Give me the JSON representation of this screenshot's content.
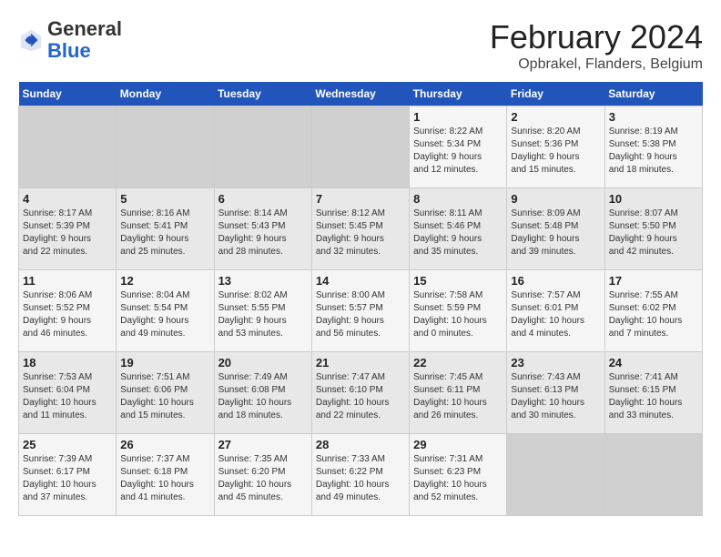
{
  "header": {
    "logo_general": "General",
    "logo_blue": "Blue",
    "main_title": "February 2024",
    "subtitle": "Opbrakel, Flanders, Belgium"
  },
  "days_of_week": [
    "Sunday",
    "Monday",
    "Tuesday",
    "Wednesday",
    "Thursday",
    "Friday",
    "Saturday"
  ],
  "weeks": [
    [
      {
        "day": "",
        "info": ""
      },
      {
        "day": "",
        "info": ""
      },
      {
        "day": "",
        "info": ""
      },
      {
        "day": "",
        "info": ""
      },
      {
        "day": "1",
        "info": "Sunrise: 8:22 AM\nSunset: 5:34 PM\nDaylight: 9 hours\nand 12 minutes."
      },
      {
        "day": "2",
        "info": "Sunrise: 8:20 AM\nSunset: 5:36 PM\nDaylight: 9 hours\nand 15 minutes."
      },
      {
        "day": "3",
        "info": "Sunrise: 8:19 AM\nSunset: 5:38 PM\nDaylight: 9 hours\nand 18 minutes."
      }
    ],
    [
      {
        "day": "4",
        "info": "Sunrise: 8:17 AM\nSunset: 5:39 PM\nDaylight: 9 hours\nand 22 minutes."
      },
      {
        "day": "5",
        "info": "Sunrise: 8:16 AM\nSunset: 5:41 PM\nDaylight: 9 hours\nand 25 minutes."
      },
      {
        "day": "6",
        "info": "Sunrise: 8:14 AM\nSunset: 5:43 PM\nDaylight: 9 hours\nand 28 minutes."
      },
      {
        "day": "7",
        "info": "Sunrise: 8:12 AM\nSunset: 5:45 PM\nDaylight: 9 hours\nand 32 minutes."
      },
      {
        "day": "8",
        "info": "Sunrise: 8:11 AM\nSunset: 5:46 PM\nDaylight: 9 hours\nand 35 minutes."
      },
      {
        "day": "9",
        "info": "Sunrise: 8:09 AM\nSunset: 5:48 PM\nDaylight: 9 hours\nand 39 minutes."
      },
      {
        "day": "10",
        "info": "Sunrise: 8:07 AM\nSunset: 5:50 PM\nDaylight: 9 hours\nand 42 minutes."
      }
    ],
    [
      {
        "day": "11",
        "info": "Sunrise: 8:06 AM\nSunset: 5:52 PM\nDaylight: 9 hours\nand 46 minutes."
      },
      {
        "day": "12",
        "info": "Sunrise: 8:04 AM\nSunset: 5:54 PM\nDaylight: 9 hours\nand 49 minutes."
      },
      {
        "day": "13",
        "info": "Sunrise: 8:02 AM\nSunset: 5:55 PM\nDaylight: 9 hours\nand 53 minutes."
      },
      {
        "day": "14",
        "info": "Sunrise: 8:00 AM\nSunset: 5:57 PM\nDaylight: 9 hours\nand 56 minutes."
      },
      {
        "day": "15",
        "info": "Sunrise: 7:58 AM\nSunset: 5:59 PM\nDaylight: 10 hours\nand 0 minutes."
      },
      {
        "day": "16",
        "info": "Sunrise: 7:57 AM\nSunset: 6:01 PM\nDaylight: 10 hours\nand 4 minutes."
      },
      {
        "day": "17",
        "info": "Sunrise: 7:55 AM\nSunset: 6:02 PM\nDaylight: 10 hours\nand 7 minutes."
      }
    ],
    [
      {
        "day": "18",
        "info": "Sunrise: 7:53 AM\nSunset: 6:04 PM\nDaylight: 10 hours\nand 11 minutes."
      },
      {
        "day": "19",
        "info": "Sunrise: 7:51 AM\nSunset: 6:06 PM\nDaylight: 10 hours\nand 15 minutes."
      },
      {
        "day": "20",
        "info": "Sunrise: 7:49 AM\nSunset: 6:08 PM\nDaylight: 10 hours\nand 18 minutes."
      },
      {
        "day": "21",
        "info": "Sunrise: 7:47 AM\nSunset: 6:10 PM\nDaylight: 10 hours\nand 22 minutes."
      },
      {
        "day": "22",
        "info": "Sunrise: 7:45 AM\nSunset: 6:11 PM\nDaylight: 10 hours\nand 26 minutes."
      },
      {
        "day": "23",
        "info": "Sunrise: 7:43 AM\nSunset: 6:13 PM\nDaylight: 10 hours\nand 30 minutes."
      },
      {
        "day": "24",
        "info": "Sunrise: 7:41 AM\nSunset: 6:15 PM\nDaylight: 10 hours\nand 33 minutes."
      }
    ],
    [
      {
        "day": "25",
        "info": "Sunrise: 7:39 AM\nSunset: 6:17 PM\nDaylight: 10 hours\nand 37 minutes."
      },
      {
        "day": "26",
        "info": "Sunrise: 7:37 AM\nSunset: 6:18 PM\nDaylight: 10 hours\nand 41 minutes."
      },
      {
        "day": "27",
        "info": "Sunrise: 7:35 AM\nSunset: 6:20 PM\nDaylight: 10 hours\nand 45 minutes."
      },
      {
        "day": "28",
        "info": "Sunrise: 7:33 AM\nSunset: 6:22 PM\nDaylight: 10 hours\nand 49 minutes."
      },
      {
        "day": "29",
        "info": "Sunrise: 7:31 AM\nSunset: 6:23 PM\nDaylight: 10 hours\nand 52 minutes."
      },
      {
        "day": "",
        "info": ""
      },
      {
        "day": "",
        "info": ""
      }
    ]
  ]
}
